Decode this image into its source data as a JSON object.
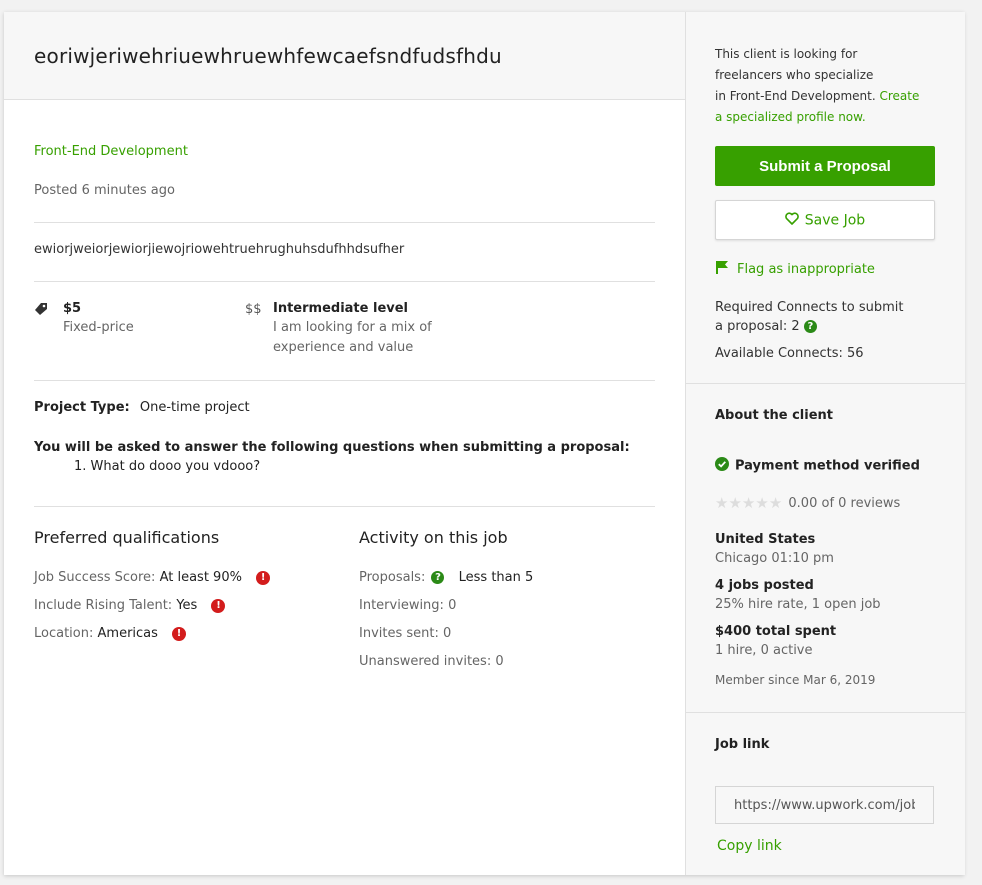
{
  "job": {
    "title": "eoriwjeriwehriuewhruewhfewcaefsndfudsfhdu",
    "category": "Front-End Development",
    "posted": "Posted 6 minutes ago",
    "description": "ewiorjweiorjewiorjiewojriowehtruehrughuhsdufhhdsufher",
    "price": "$5",
    "price_type": "Fixed-price",
    "level_icon": "$$",
    "level": "Intermediate level",
    "level_desc_1": "I am looking for a mix of",
    "level_desc_2": "experience and value",
    "project_type_label": "Project Type:",
    "project_type": "One-time project",
    "questions_heading": "You will be asked to answer the following questions when submitting a proposal:",
    "questions": [
      "1. What do dooo you vdooo?"
    ]
  },
  "qualifications": {
    "heading": "Preferred qualifications",
    "items": [
      {
        "label": "Job Success Score:",
        "value": "At least 90%"
      },
      {
        "label": "Include Rising Talent:",
        "value": "Yes"
      },
      {
        "label": "Location:",
        "value": "Americas"
      }
    ]
  },
  "activity": {
    "heading": "Activity on this job",
    "proposals_label": "Proposals:",
    "proposals_value": "Less than 5",
    "items": [
      "Interviewing: 0",
      "Invites sent: 0",
      "Unanswered invites: 0"
    ]
  },
  "sidebar": {
    "notice_1": "This client is looking for",
    "notice_2": "freelancers who specialize",
    "notice_3": "in Front-End Development.",
    "notice_link_1": "Create",
    "notice_link_2": "a specialized profile now.",
    "submit_label": "Submit a Proposal",
    "save_label": "Save Job",
    "flag_label": "Flag as inappropriate",
    "connects_1": "Required Connects to submit",
    "connects_2": "a proposal: 2",
    "available": "Available Connects: 56"
  },
  "client": {
    "heading": "About the client",
    "payment": "Payment method verified",
    "rating": "0.00 of 0 reviews",
    "country": "United States",
    "city_time": "Chicago 01:10 pm",
    "jobs_posted": "4 jobs posted",
    "hire_rate": "25% hire rate, 1 open job",
    "spent": "$400 total spent",
    "hires": "1 hire, 0 active",
    "member_since": "Member since Mar 6, 2019"
  },
  "job_link": {
    "heading": "Job link",
    "url": "https://www.upwork.com/job/",
    "copy_label": "Copy link"
  },
  "colors": {
    "accent": "#37a000",
    "alert": "#d31c1c",
    "verified": "#2b8a17"
  }
}
